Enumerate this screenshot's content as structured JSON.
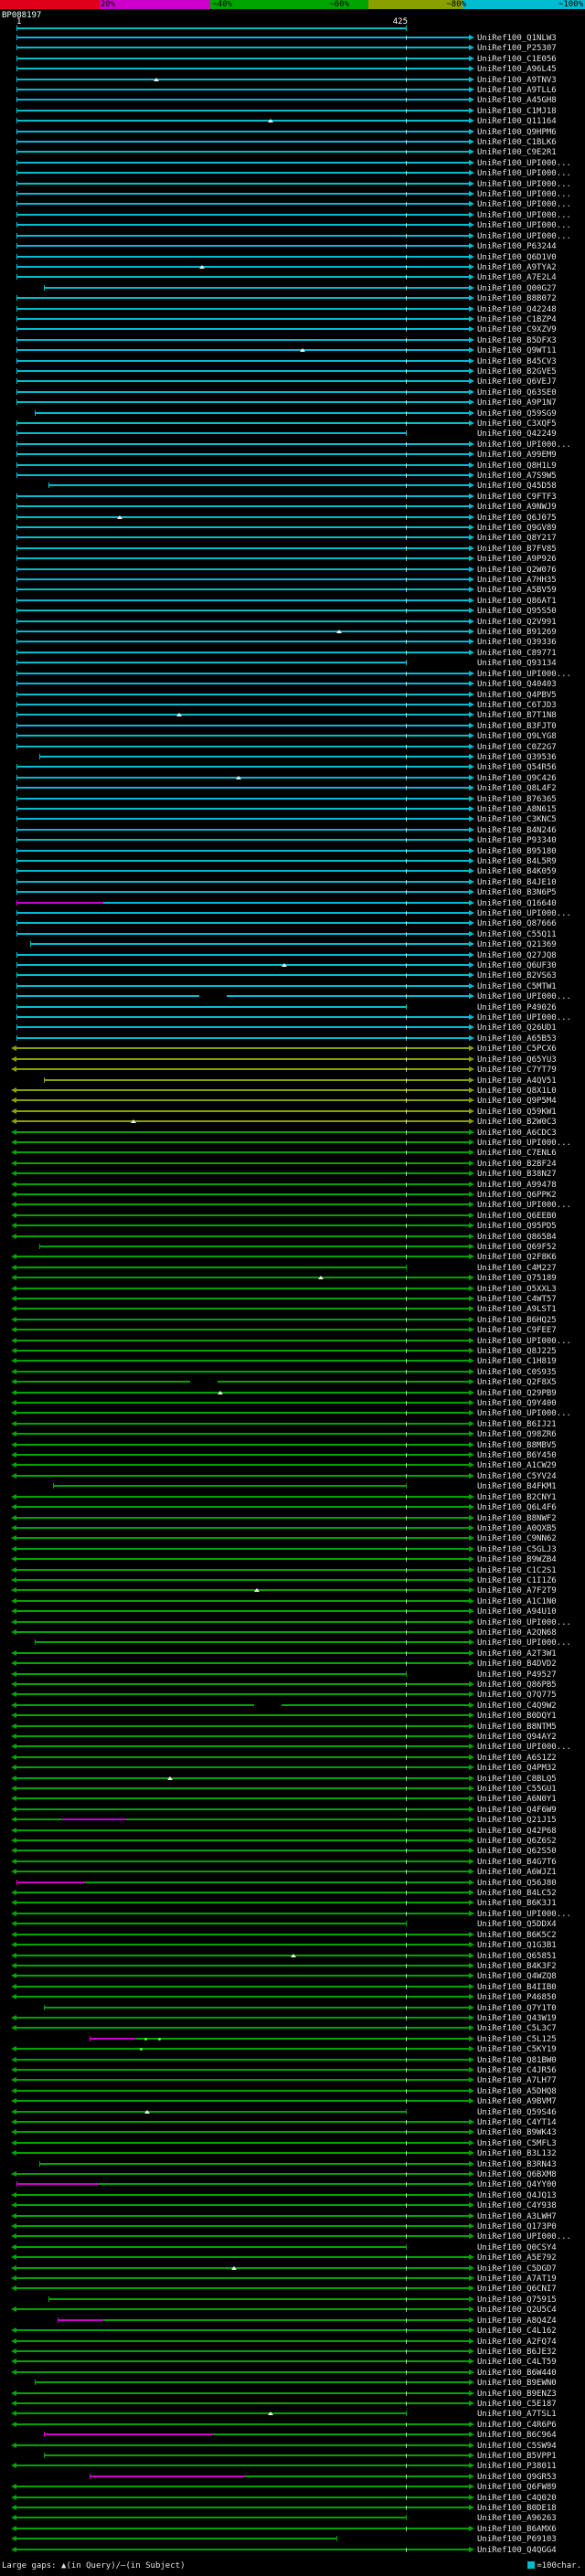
{
  "colors": {
    "c": "#00bcd0",
    "g": "#00a400",
    "m": "#cc00cc",
    "o": "#8aa000",
    "mark": "#f0f0f0",
    "dot": "#55ff55"
  },
  "scale_bar": {
    "segments": [
      {
        "to_pct": 17,
        "color": "#e10019"
      },
      {
        "to_pct": 36,
        "color": "#cc00cc"
      },
      {
        "to_pct": 63,
        "color": "#00a400"
      },
      {
        "to_pct": 79,
        "color": "#8aa000"
      },
      {
        "to_pct": 100,
        "color": "#00bcd0"
      }
    ],
    "labels": [
      {
        "text": "20%",
        "at_pct": 20
      },
      {
        "text": "~40%",
        "at_pct": 40
      },
      {
        "text": "~60%",
        "at_pct": 60
      },
      {
        "text": "~80%",
        "at_pct": 80
      },
      {
        "text": "~100%",
        "at_pct": 100
      }
    ]
  },
  "query": {
    "name": "BP088197",
    "start_label": "1",
    "end_label": "425"
  },
  "footer": {
    "left": "Large gaps: ▲(in Query)/—(in Subject)",
    "right_text": "=100char."
  },
  "chart_data": {
    "type": "bar",
    "orientation": "horizontal",
    "title": "",
    "x_axis": {
      "query_start": 1,
      "query_end": 425
    },
    "query": {
      "name": "BP088197",
      "length": 425
    },
    "id_prefix": "UniRef100_",
    "row_defaults": {
      "start_pct": 0,
      "end_pct": 99,
      "right_arrow": true,
      "left_arrow_colors": [
        "g",
        "o"
      ],
      "query_end_tick_pct": 85.2,
      "query_end_tick_min_end": 86,
      "color_zones": [
        {
          "from": 0,
          "to": 96,
          "color": "c"
        },
        {
          "from": 97,
          "to": 104,
          "color": "o"
        },
        {
          "from": 105,
          "to": 241,
          "color": "g"
        }
      ]
    },
    "rows": [
      {
        "l": "Q1NLW3"
      },
      {
        "l": "P25307"
      },
      {
        "l": "C1E056"
      },
      {
        "l": "A96L45"
      },
      {
        "l": "A9TNV3",
        "marks": [
          [
            30,
            "tri"
          ]
        ]
      },
      {
        "l": "A9TLL6"
      },
      {
        "l": "A45GH8"
      },
      {
        "l": "C1MJ18"
      },
      {
        "l": "Q11164",
        "marks": [
          [
            55,
            "tri"
          ]
        ]
      },
      {
        "l": "Q9HPM6"
      },
      {
        "l": "C1BLK6"
      },
      {
        "l": "C9E2R1"
      },
      {
        "l": "UPI000..."
      },
      {
        "l": "UPI000..."
      },
      {
        "l": "UPI000..."
      },
      {
        "l": "UPI000..."
      },
      {
        "l": "UPI000..."
      },
      {
        "l": "UPI000..."
      },
      {
        "l": "UPI000..."
      },
      {
        "l": "UPI000..."
      },
      {
        "l": "P63244"
      },
      {
        "l": "Q6D1V0"
      },
      {
        "l": "A9TYA2",
        "marks": [
          [
            40,
            "tri"
          ]
        ]
      },
      {
        "l": "A7E2L4"
      },
      {
        "l": "Q00G27",
        "s": 6
      },
      {
        "l": "B8B072"
      },
      {
        "l": "Q42248"
      },
      {
        "l": "C1BZP4"
      },
      {
        "l": "C9XZV9"
      },
      {
        "l": "B5DFX3"
      },
      {
        "l": "Q9WT11",
        "marks": [
          [
            62,
            "tri"
          ]
        ]
      },
      {
        "l": "B45CV3"
      },
      {
        "l": "B2GVE5"
      },
      {
        "l": "Q6VEJ7"
      },
      {
        "l": "Q63SE0"
      },
      {
        "l": "A9P1N7"
      },
      {
        "l": "Q59SG9",
        "s": 4
      },
      {
        "l": "C3XQF5"
      },
      {
        "l": "Q42249",
        "e": 85.2,
        "ra": false
      },
      {
        "l": "UPI000..."
      },
      {
        "l": "A99EM9"
      },
      {
        "l": "Q8H1L9"
      },
      {
        "l": "A7S9W5"
      },
      {
        "l": "Q45D58",
        "s": 7
      },
      {
        "l": "C9FTF3"
      },
      {
        "l": "A9NWJ9"
      },
      {
        "l": "Q6J075",
        "marks": [
          [
            22,
            "tri"
          ]
        ]
      },
      {
        "l": "Q9GV89"
      },
      {
        "l": "Q8Y217"
      },
      {
        "l": "B7FV85"
      },
      {
        "l": "A9P926"
      },
      {
        "l": "Q2W076"
      },
      {
        "l": "A7HH35"
      },
      {
        "l": "A5BV59"
      },
      {
        "l": "Q86AT1"
      },
      {
        "l": "Q95S50"
      },
      {
        "l": "Q2V991"
      },
      {
        "l": "B91269",
        "marks": [
          [
            70,
            "tri"
          ]
        ]
      },
      {
        "l": "Q39336"
      },
      {
        "l": "C89771"
      },
      {
        "l": "Q93134",
        "e": 85.2,
        "ra": false
      },
      {
        "l": "UPI000..."
      },
      {
        "l": "Q40403"
      },
      {
        "l": "Q4PBV5"
      },
      {
        "l": "C6TJD3"
      },
      {
        "l": "B7T1N8",
        "marks": [
          [
            35,
            "tri"
          ]
        ]
      },
      {
        "l": "B3FJT0"
      },
      {
        "l": "Q9LYG8"
      },
      {
        "l": "C0Z2G7"
      },
      {
        "l": "Q39536",
        "s": 5
      },
      {
        "l": "Q54R56"
      },
      {
        "l": "Q9C426",
        "marks": [
          [
            48,
            "tri"
          ]
        ]
      },
      {
        "l": "Q8L4F2"
      },
      {
        "l": "B76365"
      },
      {
        "l": "A8N615"
      },
      {
        "l": "C3KNC5"
      },
      {
        "l": "B4N246"
      },
      {
        "l": "P93340"
      },
      {
        "l": "B95180"
      },
      {
        "l": "B4L5R9"
      },
      {
        "l": "B4K059"
      },
      {
        "l": "B4JE10"
      },
      {
        "l": "B3N6P5"
      },
      {
        "l": "Q16640",
        "segs": [
          [
            0,
            19,
            "m"
          ],
          [
            19,
            99,
            "c"
          ]
        ]
      },
      {
        "l": "UPI000..."
      },
      {
        "l": "Q87666"
      },
      {
        "l": "C55Q11"
      },
      {
        "l": "Q21369",
        "s": 3
      },
      {
        "l": "Q27JQ8"
      },
      {
        "l": "Q6UF30",
        "marks": [
          [
            58,
            "tri"
          ]
        ]
      },
      {
        "l": "B2VS63"
      },
      {
        "l": "C5MTW1"
      },
      {
        "l": "UPI000...",
        "segs": [
          [
            0,
            40,
            "c"
          ],
          [
            46,
            99,
            "c"
          ]
        ]
      },
      {
        "l": "P49026",
        "e": 85.2,
        "ra": false
      },
      {
        "l": "UPI000..."
      },
      {
        "l": "Q26UD1"
      },
      {
        "l": "A65B53"
      },
      {
        "l": "C5PCX6",
        "c": "o"
      },
      {
        "l": "Q65YU3",
        "c": "o"
      },
      {
        "l": "C7YT79",
        "c": "o"
      },
      {
        "l": "A4QV51",
        "c": "o",
        "s": 6
      },
      {
        "l": "Q8X1L0",
        "c": "o"
      },
      {
        "l": "Q9P5M4",
        "c": "o"
      },
      {
        "l": "Q59KW1",
        "c": "o"
      },
      {
        "l": "B2W0C3",
        "c": "o",
        "marks": [
          [
            25,
            "tri"
          ]
        ]
      },
      {
        "l": "A6CDC3"
      },
      {
        "l": "UPI000..."
      },
      {
        "l": "C7ENL6"
      },
      {
        "l": "B2BF24"
      },
      {
        "l": "B38N27"
      },
      {
        "l": "A99478"
      },
      {
        "l": "Q6PPK2"
      },
      {
        "l": "UPI000..."
      },
      {
        "l": "Q6EEB0"
      },
      {
        "l": "Q95PD5"
      },
      {
        "l": "Q865B4"
      },
      {
        "l": "Q69F52",
        "s": 5
      },
      {
        "l": "Q2F8K6"
      },
      {
        "l": "C4M227",
        "e": 85.2,
        "ra": false
      },
      {
        "l": "Q75189",
        "marks": [
          [
            66,
            "tri"
          ]
        ]
      },
      {
        "l": "O5XXL3"
      },
      {
        "l": "C4WT57"
      },
      {
        "l": "A9LST1"
      },
      {
        "l": "B6HQ25"
      },
      {
        "l": "C9FEE7"
      },
      {
        "l": "UPI000..."
      },
      {
        "l": "Q8J225"
      },
      {
        "l": "C1H819"
      },
      {
        "l": "C0S935"
      },
      {
        "l": "Q2F8X5",
        "segs": [
          [
            0,
            38,
            "g"
          ],
          [
            44,
            99,
            "g"
          ]
        ]
      },
      {
        "l": "Q29PB9",
        "marks": [
          [
            44,
            "tri"
          ]
        ]
      },
      {
        "l": "Q9Y400"
      },
      {
        "l": "UPI000..."
      },
      {
        "l": "B6IJ21"
      },
      {
        "l": "Q98ZR6"
      },
      {
        "l": "B8MBV5"
      },
      {
        "l": "B6Y450"
      },
      {
        "l": "A1CW29"
      },
      {
        "l": "C5YV24"
      },
      {
        "l": "B4FKM1",
        "s": 8,
        "e": 85.2,
        "ra": false
      },
      {
        "l": "B2CNY1"
      },
      {
        "l": "Q6L4F6"
      },
      {
        "l": "B8NWF2"
      },
      {
        "l": "A0QXB5"
      },
      {
        "l": "C9NN62"
      },
      {
        "l": "C5GLJ3"
      },
      {
        "l": "B9WZB4"
      },
      {
        "l": "C1C2S1"
      },
      {
        "l": "C1I1Z6"
      },
      {
        "l": "A7F2T9",
        "marks": [
          [
            52,
            "tri"
          ]
        ]
      },
      {
        "l": "A1C1N0"
      },
      {
        "l": "A94U10"
      },
      {
        "l": "UPI000..."
      },
      {
        "l": "A2QN68"
      },
      {
        "l": "UPI000...",
        "s": 4
      },
      {
        "l": "A2T3W1"
      },
      {
        "l": "B4DVD2"
      },
      {
        "l": "P49527",
        "e": 85.2,
        "ra": false
      },
      {
        "l": "Q86PB5"
      },
      {
        "l": "Q7Q775"
      },
      {
        "l": "C4Q9W2",
        "segs": [
          [
            0,
            52,
            "g"
          ],
          [
            58,
            99,
            "g"
          ]
        ]
      },
      {
        "l": "B0DQY1"
      },
      {
        "l": "B8NTM5"
      },
      {
        "l": "Q94AY2"
      },
      {
        "l": "UPI000..."
      },
      {
        "l": "A6S1Z2"
      },
      {
        "l": "Q4PM32"
      },
      {
        "l": "C8BLQ5",
        "marks": [
          [
            33,
            "tri"
          ]
        ]
      },
      {
        "l": "C55GU1"
      },
      {
        "l": "A6N0Y1"
      },
      {
        "l": "Q4F6W9"
      },
      {
        "l": "Q21J15",
        "segs": [
          [
            0,
            10,
            "g"
          ],
          [
            10,
            24,
            "m"
          ],
          [
            24,
            99,
            "g"
          ]
        ]
      },
      {
        "l": "Q42P68"
      },
      {
        "l": "Q6Z6S2"
      },
      {
        "l": "Q62S50"
      },
      {
        "l": "B4G7T6"
      },
      {
        "l": "A6WJZ1"
      },
      {
        "l": "Q56J80",
        "segs": [
          [
            0,
            15,
            "m"
          ],
          [
            15,
            99,
            "g"
          ]
        ]
      },
      {
        "l": "B4LC52"
      },
      {
        "l": "B6K3J1"
      },
      {
        "l": "UPI000..."
      },
      {
        "l": "Q5DDX4",
        "e": 85.2,
        "ra": false
      },
      {
        "l": "B6K5C2"
      },
      {
        "l": "Q1G3B1"
      },
      {
        "l": "Q65851",
        "marks": [
          [
            60,
            "tri"
          ]
        ]
      },
      {
        "l": "B4K3F2"
      },
      {
        "l": "Q4WZQ8"
      },
      {
        "l": "B4IIB0"
      },
      {
        "l": "P46850"
      },
      {
        "l": "Q7Y1T0",
        "s": 6
      },
      {
        "l": "Q43W19"
      },
      {
        "l": "C5L3C7"
      },
      {
        "l": "C5L125",
        "segs": [
          [
            16,
            26,
            "m"
          ],
          [
            26,
            99,
            "g"
          ]
        ],
        "marks": [
          [
            28,
            "dot"
          ],
          [
            31,
            "dot"
          ]
        ]
      },
      {
        "l": "C5KY19",
        "marks": [
          [
            27,
            "dot"
          ]
        ]
      },
      {
        "l": "Q81BW0"
      },
      {
        "l": "C4JR56"
      },
      {
        "l": "A7LH77"
      },
      {
        "l": "A5DHQ8"
      },
      {
        "l": "A9BVM7"
      },
      {
        "l": "Q59S46",
        "e": 85.2,
        "ra": false,
        "marks": [
          [
            28,
            "tri"
          ]
        ]
      },
      {
        "l": "C4YT14"
      },
      {
        "l": "B9WK43"
      },
      {
        "l": "C5MFL3"
      },
      {
        "l": "B3L132"
      },
      {
        "l": "B3RN43",
        "s": 5
      },
      {
        "l": "Q6BXM8"
      },
      {
        "l": "Q4YY00",
        "segs": [
          [
            0,
            18,
            "m"
          ],
          [
            18,
            99,
            "g"
          ]
        ]
      },
      {
        "l": "Q4JQ13"
      },
      {
        "l": "C4Y938"
      },
      {
        "l": "A3LWH7"
      },
      {
        "l": "Q173P0"
      },
      {
        "l": "UPI000..."
      },
      {
        "l": "Q0CSY4",
        "e": 85.2,
        "ra": false
      },
      {
        "l": "A5E792"
      },
      {
        "l": "C5DGD7",
        "marks": [
          [
            47,
            "tri"
          ]
        ]
      },
      {
        "l": "A7AT19"
      },
      {
        "l": "Q6CNI7"
      },
      {
        "l": "Q75915",
        "s": 7
      },
      {
        "l": "Q2U5C4"
      },
      {
        "l": "A8Q4Z4",
        "segs": [
          [
            9,
            19,
            "m"
          ],
          [
            19,
            99,
            "g"
          ]
        ]
      },
      {
        "l": "C4L162"
      },
      {
        "l": "A2FQ74"
      },
      {
        "l": "B6JE32"
      },
      {
        "l": "C4LT59"
      },
      {
        "l": "B6W440"
      },
      {
        "l": "B9EWN0",
        "s": 4
      },
      {
        "l": "B9ENZ3"
      },
      {
        "l": "C5E187"
      },
      {
        "l": "A7TSL1",
        "e": 85.2,
        "ra": false,
        "marks": [
          [
            55,
            "tri"
          ]
        ]
      },
      {
        "l": "C4R6P6"
      },
      {
        "l": "B6C964",
        "segs": [
          [
            6,
            43,
            "m"
          ],
          [
            43,
            99,
            "g"
          ]
        ]
      },
      {
        "l": "C5SW94"
      },
      {
        "l": "B5VPP1",
        "s": 6
      },
      {
        "l": "P38011"
      },
      {
        "l": "Q9GR53",
        "segs": [
          [
            16,
            50,
            "m"
          ],
          [
            50,
            99,
            "g"
          ]
        ]
      },
      {
        "l": "Q6FW89"
      },
      {
        "l": "C4Q020"
      },
      {
        "l": "B0DE18"
      },
      {
        "l": "A96263",
        "e": 85.2,
        "ra": false
      },
      {
        "l": "B6AMX6"
      },
      {
        "l": "P69103",
        "e": 70,
        "ra": false
      },
      {
        "l": "Q4QGG4"
      }
    ]
  }
}
